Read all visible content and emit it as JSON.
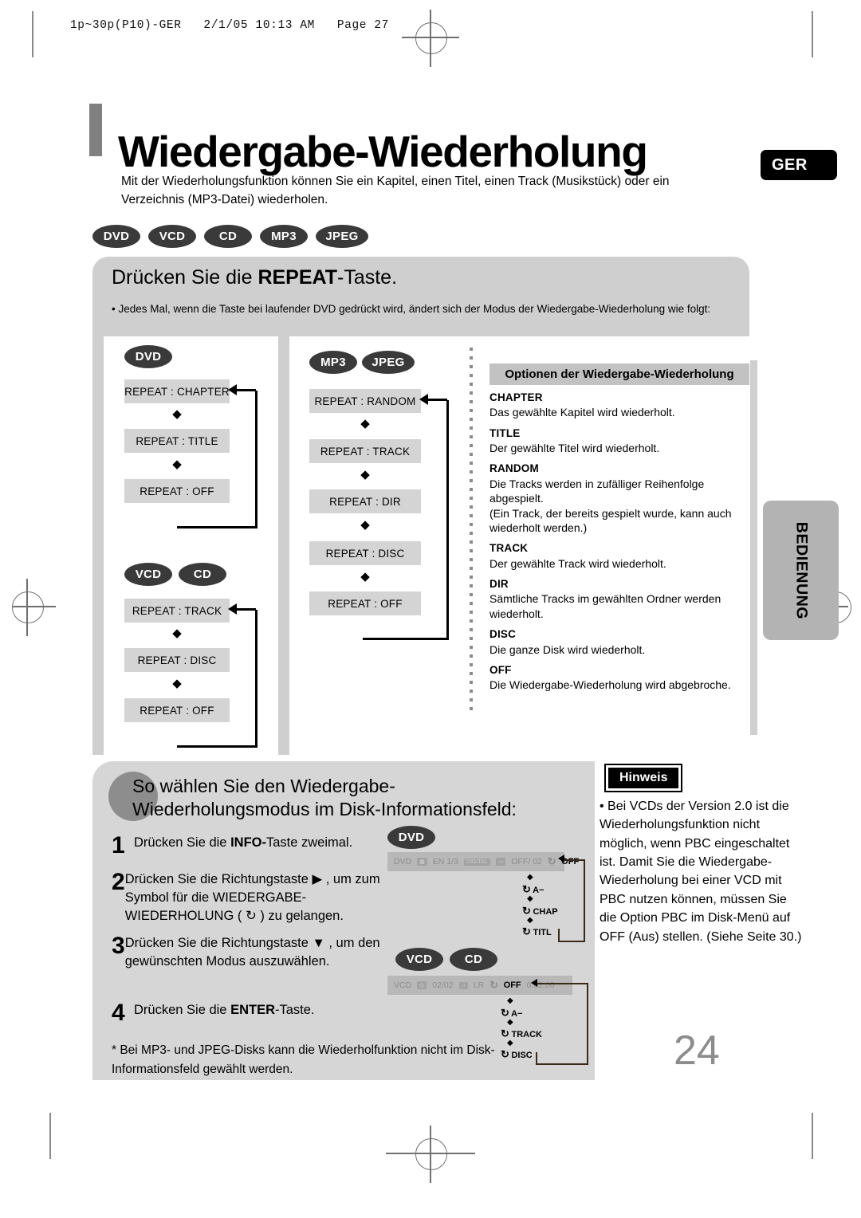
{
  "print_meta": {
    "header_line": "1p~30p(P10)-GER   2/1/05 10:13 AM   Page 27"
  },
  "header": {
    "title": "Wiedergabe-Wiederholung",
    "intro": "Mit der Wiederholungsfunktion können Sie ein Kapitel, einen Titel, einen Track (Musikstück) oder ein Verzeichnis (MP3-Datei) wiederholen.",
    "language_badge": "GER"
  },
  "side_tab": {
    "label": "BEDIENUNG"
  },
  "media_pills": [
    "DVD",
    "VCD",
    "CD",
    "MP3",
    "JPEG"
  ],
  "top_panel": {
    "heading_prefix": "Drücken Sie die ",
    "heading_bold": "REPEAT",
    "heading_suffix": "-Taste.",
    "bullet": "• Jedes Mal, wenn die Taste bei laufender DVD gedrückt wird, ändert sich der Modus der Wiedergabe-Wiederholung wie folgt:"
  },
  "flows": {
    "dvd": {
      "pills": [
        "DVD"
      ],
      "steps": [
        "REPEAT : CHAPTER",
        "REPEAT : TITLE",
        "REPEAT : OFF"
      ]
    },
    "vcd_cd": {
      "pills": [
        "VCD",
        "CD"
      ],
      "steps": [
        "REPEAT : TRACK",
        "REPEAT : DISC",
        "REPEAT : OFF"
      ]
    },
    "mp3_jpeg": {
      "pills": [
        "MP3",
        "JPEG"
      ],
      "steps": [
        "REPEAT : RANDOM",
        "REPEAT : TRACK",
        "REPEAT : DIR",
        "REPEAT : DISC",
        "REPEAT : OFF"
      ]
    },
    "arrow_glyph": "◆"
  },
  "options": {
    "title": "Optionen der Wiedergabe-Wiederholung",
    "items": [
      {
        "term": "CHAPTER",
        "desc": "Das gewählte Kapitel wird wiederholt."
      },
      {
        "term": "TITLE",
        "desc": "Der gewählte Titel wird wiederholt."
      },
      {
        "term": "RANDOM",
        "desc": "Die Tracks werden in zufälliger Reihenfolge abgespielt.\n(Ein Track, der bereits gespielt wurde, kann auch wiederholt werden.)"
      },
      {
        "term": "TRACK",
        "desc": "Der gewählte Track wird wiederholt."
      },
      {
        "term": "DIR",
        "desc": "Sämtliche Tracks im gewählten Ordner werden wiederholt."
      },
      {
        "term": "DISC",
        "desc": "Die ganze Disk wird wiederholt."
      },
      {
        "term": "OFF",
        "desc": "Die Wiedergabe-Wiederholung wird abgebroche."
      }
    ]
  },
  "procedure": {
    "heading": "So wählen Sie den Wiedergabe-Wiederholungsmodus im Disk-Informationsfeld:",
    "steps": [
      {
        "num": "1",
        "pre": "Drücken Sie die ",
        "bold": "INFO-",
        "post": "Taste zweimal."
      },
      {
        "num": "2",
        "pre": "Drücken Sie die Richtungstaste ▶ , um zum Symbol für die WIEDERGABE-WIEDERHOLUNG ( ↻ ) zu gelangen.",
        "bold": "",
        "post": ""
      },
      {
        "num": "3",
        "pre": "Drücken Sie die Richtungstaste ▼ , um den gewünschten Modus auszuwählen.",
        "bold": "",
        "post": ""
      },
      {
        "num": "4",
        "pre": "Drücken Sie die ",
        "bold": "ENTER",
        "post": "-Taste."
      }
    ],
    "footnote": "* Bei MP3- und JPEG-Disks kann die Wiederholfunktion nicht im Disk-Informationsfeld gewählt werden."
  },
  "osd_dvd": {
    "pill": "DVD",
    "bar": {
      "disc": "DVD",
      "audio": "EN 1/3",
      "subtitle": "OFF/ 02",
      "repeat": "OFF"
    },
    "cycle": [
      "A−",
      "CHAP",
      "TITL"
    ],
    "repeat_glyph": "↻",
    "diamond": "◆"
  },
  "osd_vcd": {
    "pills": [
      "VCD",
      "CD"
    ],
    "bar": {
      "disc": "VCD",
      "track": "02/02",
      "audio": "LR",
      "repeat": "OFF",
      "time": "0:02:00"
    },
    "cycle": [
      "A−",
      "TRACK",
      "DISC"
    ],
    "repeat_glyph": "↻",
    "diamond": "◆"
  },
  "note": {
    "badge": "Hinweis",
    "body": "• Bei VCDs der Version 2.0 ist die Wiederholungsfunktion nicht möglich, wenn PBC eingeschaltet ist. Damit Sie die Wiedergabe-Wiederholung bei einer VCD mit PBC nutzen können, müssen Sie die Option PBC im Disk-Menü auf OFF (Aus) stellen. (Siehe Seite 30.)"
  },
  "page_number": "24"
}
